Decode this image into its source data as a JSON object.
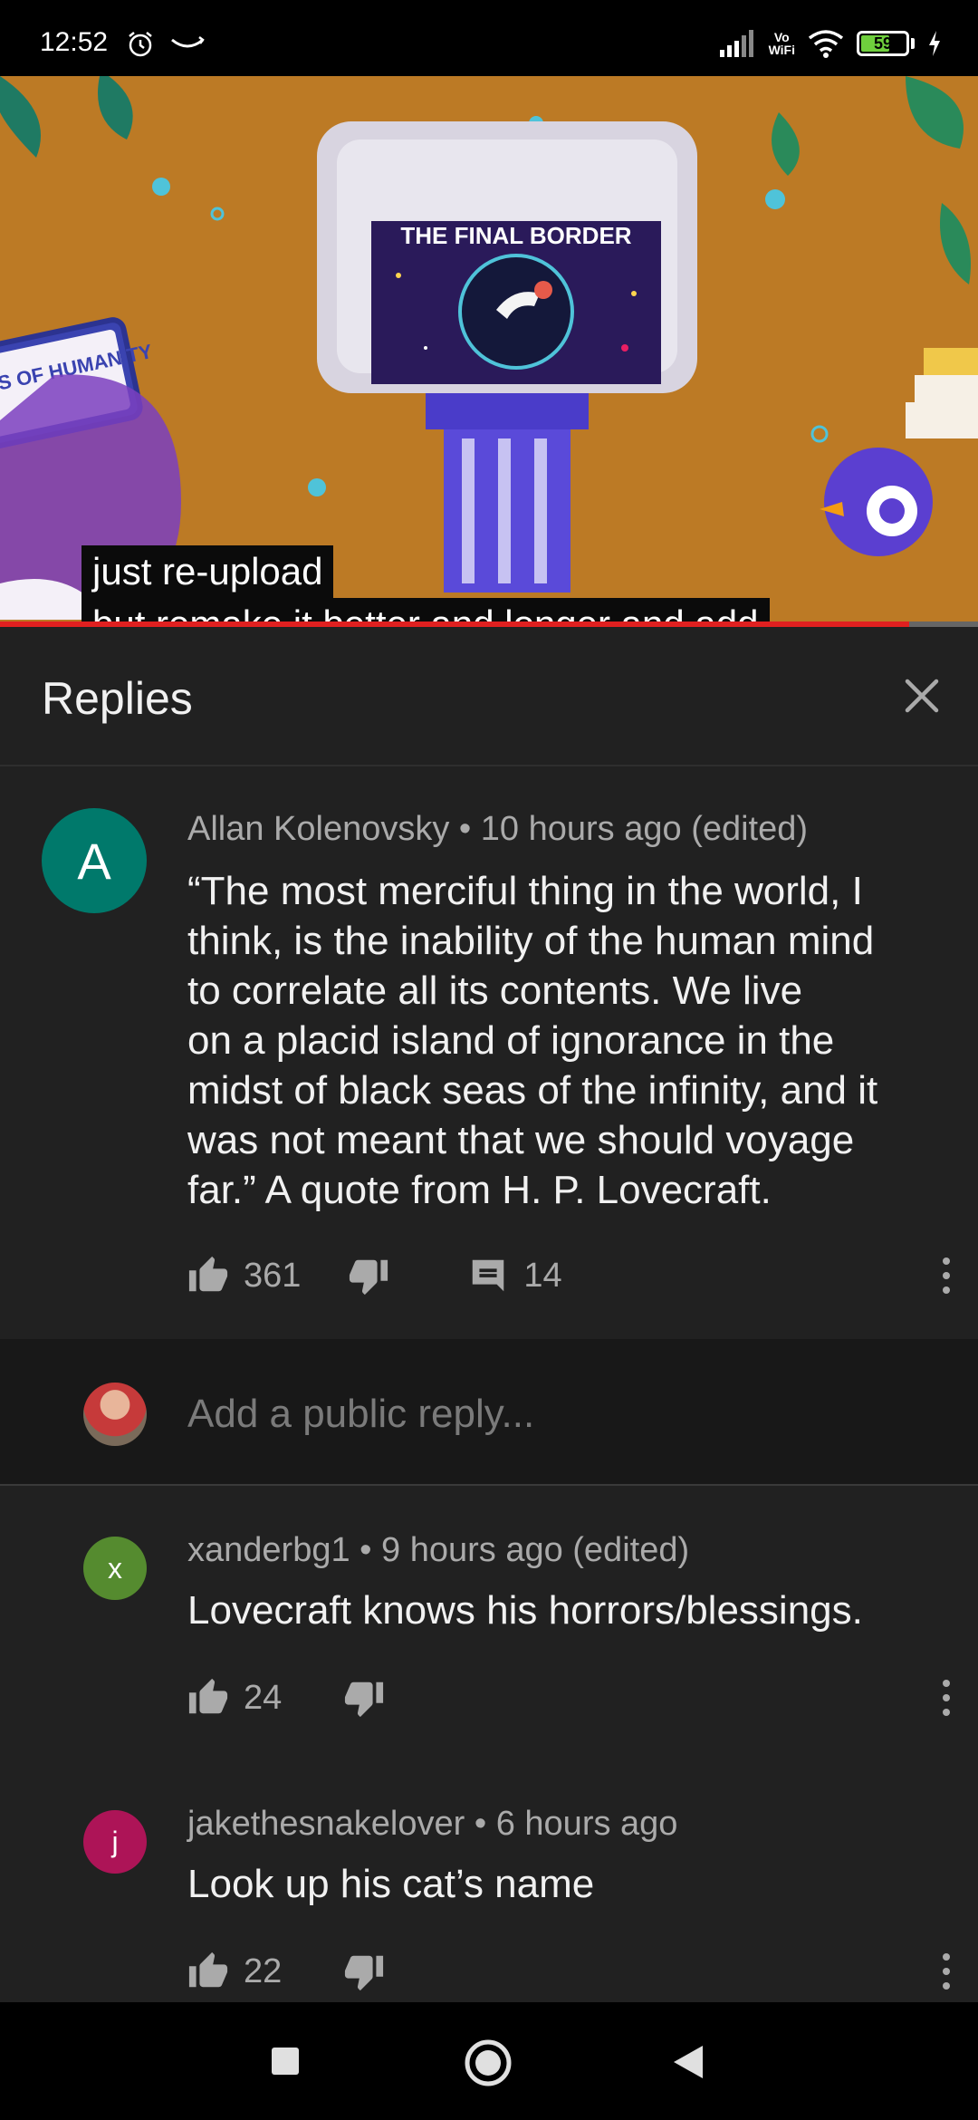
{
  "status_bar": {
    "time": "12:52",
    "vowifi_top": "Vo",
    "vowifi_bottom": "WiFi",
    "battery": "59"
  },
  "video": {
    "screen_title": "THE FINAL BORDER",
    "sign_text": "LIMITS OF HUMANITY",
    "caption_line1": "just re-upload",
    "caption_line2": "but remake it better and longer and add",
    "progress": 0.93
  },
  "replies_panel": {
    "title": "Replies"
  },
  "main_comment": {
    "avatar_letter": "A",
    "meta": "Allan Kolenovsky • 10 hours ago (edited)",
    "text_lines": [
      "“The most merciful thing in the world, I",
      "think, is the inability of the human mind",
      "to correlate all its contents. We live",
      "on a placid island of ignorance in the",
      "midst of black seas of the infinity, and it",
      "was not meant that we should voyage",
      "far.” A quote from H. P. Lovecraft."
    ],
    "likes": "361",
    "replies": "14"
  },
  "reply_input": {
    "placeholder": "Add a public reply..."
  },
  "replies": [
    {
      "avatar_letter": "x",
      "avatar_color": "#558b2f",
      "meta": "xanderbg1 • 9 hours ago (edited)",
      "text": "Lovecraft knows his horrors/blessings.",
      "likes": "24"
    },
    {
      "avatar_letter": "j",
      "avatar_color": "#ad1457",
      "meta": "jakethesnakelover • 6 hours ago",
      "text": "Look up his cat’s name",
      "likes": "22"
    }
  ]
}
